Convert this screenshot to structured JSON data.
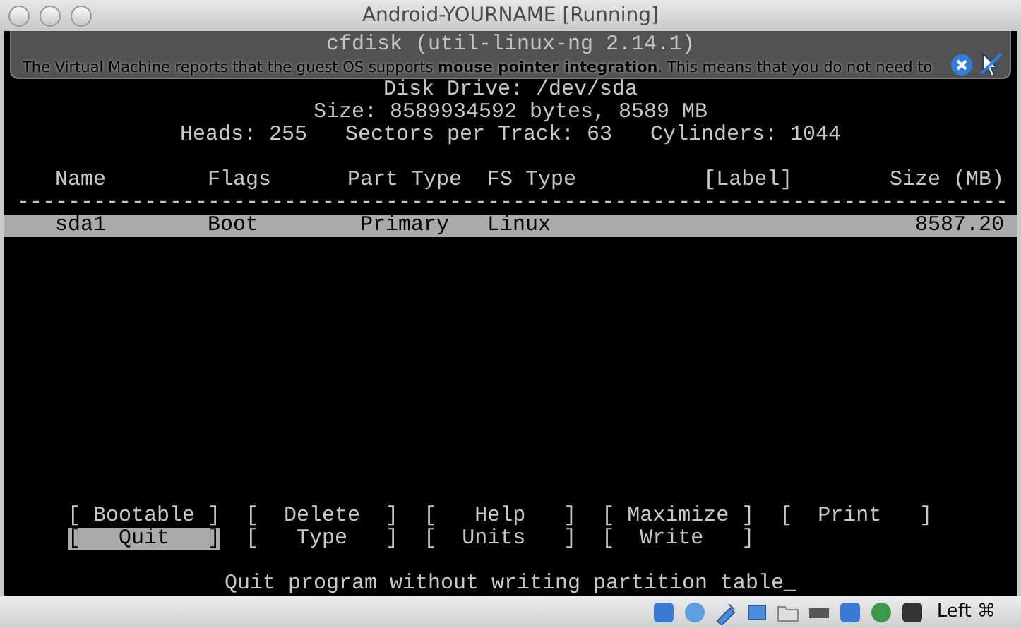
{
  "window": {
    "title": "Android-YOURNAME [Running]"
  },
  "notification": {
    "text": "The Virtual Machine reports that the guest OS supports **mouse pointer integration**. This means that you do not need to"
  },
  "console": {
    "title": "cfdisk (util-linux-ng 2.14.1)",
    "disk_drive": "Disk Drive: /dev/sda",
    "size": "Size: 8589934592 bytes, 8589 MB",
    "geometry": "Heads: 255   Sectors per Track: 63   Cylinders: 1044",
    "table": {
      "columns": [
        "Name",
        "Flags",
        "Part Type",
        "FS Type",
        "[Label]",
        "Size (MB)"
      ],
      "separator": "------------------------------------------------------------------------------",
      "rows": [
        {
          "name": "sda1",
          "flags": "Boot",
          "part_type": "Primary",
          "fs_type": "Linux",
          "size": "8587.20",
          "selected": true
        }
      ]
    },
    "menu": [
      [
        {
          "label": "[ Bootable ]",
          "selected": false
        },
        {
          "label": "[  Delete  ]",
          "selected": false
        },
        {
          "label": "[   Help   ]",
          "selected": false
        },
        {
          "label": "[ Maximize ]",
          "selected": false
        },
        {
          "label": "[  Print   ]",
          "selected": false
        }
      ],
      [
        {
          "label": "[   Quit   ]",
          "selected": true
        },
        {
          "label": "[   Type   ]",
          "selected": false
        },
        {
          "label": "[  Units   ]",
          "selected": false
        },
        {
          "label": "[  Write   ]",
          "selected": false
        }
      ]
    ],
    "message": "Quit program without writing partition table_"
  },
  "status_bar": {
    "host_key": "Left ⌘"
  }
}
